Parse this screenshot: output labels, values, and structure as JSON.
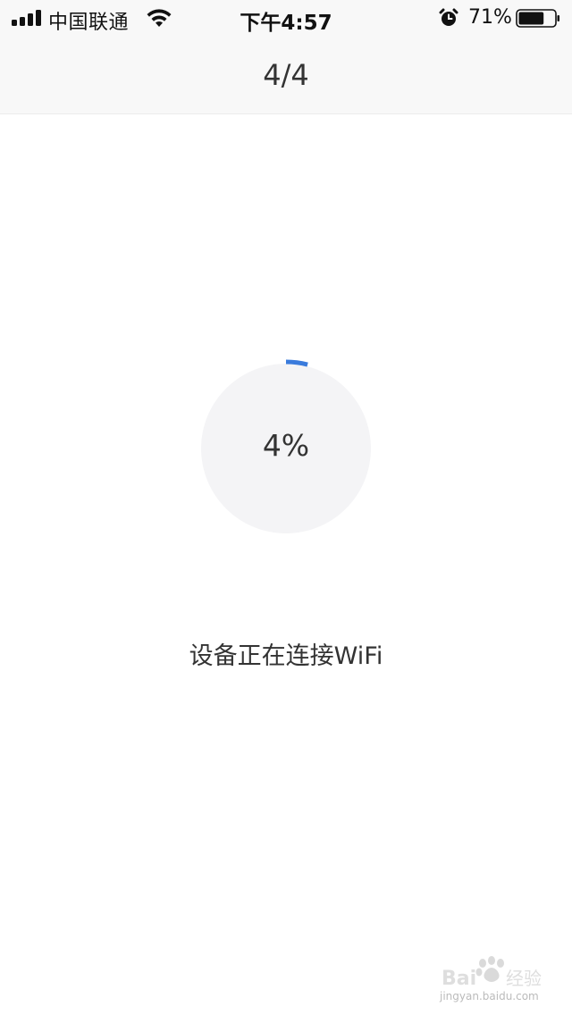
{
  "status_bar": {
    "carrier": "中国联通",
    "time": "下午4:57",
    "battery_percent": "71%",
    "battery_level": 0.71,
    "icons": [
      "signal-icon",
      "wifi-icon",
      "alarm-icon",
      "battery-icon"
    ]
  },
  "nav": {
    "title": "4/4"
  },
  "progress": {
    "label": "4%",
    "value": 0.04,
    "accent_color": "#3a7bdc",
    "track_color": "#f4f4f6"
  },
  "status_message": "设备正在连接WiFi",
  "watermark": {
    "brand": "Bai 经验",
    "url": "jingyan.baidu.com"
  }
}
